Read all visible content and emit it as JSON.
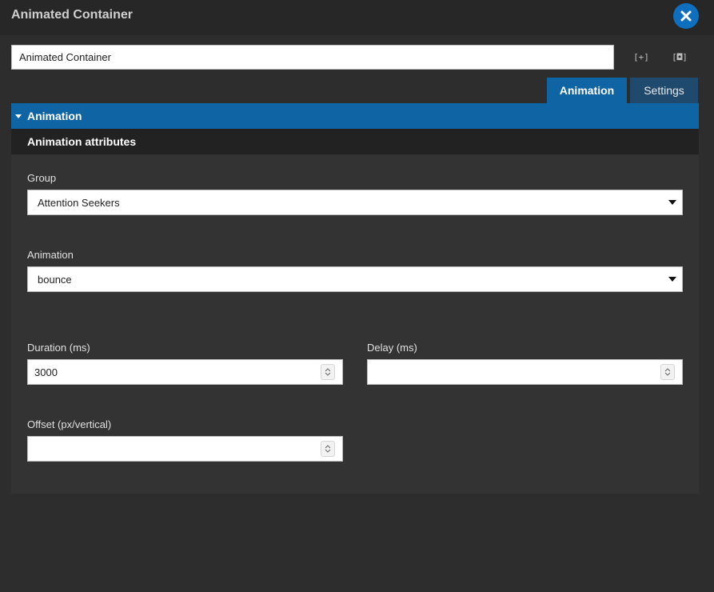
{
  "header": {
    "title": "Animated Container"
  },
  "toolbar": {
    "name_value": "Animated Container",
    "expand_icon_text": "[+]",
    "inspect_icon_text": "[◘]"
  },
  "tabs": [
    {
      "label": "Animation",
      "active": true
    },
    {
      "label": "Settings",
      "active": false
    }
  ],
  "section": {
    "title": "Animation",
    "subtitle": "Animation attributes"
  },
  "fields": {
    "group": {
      "label": "Group",
      "value": "Attention Seekers"
    },
    "animation": {
      "label": "Animation",
      "value": "bounce"
    },
    "duration": {
      "label": "Duration (ms)",
      "value": "3000"
    },
    "delay": {
      "label": "Delay (ms)",
      "value": ""
    },
    "offset": {
      "label": "Offset (px/vertical)",
      "value": ""
    }
  },
  "colors": {
    "accent": "#0f64a3",
    "background": "#2d2d2d",
    "panel": "#333333",
    "subheader": "#222222"
  },
  "icons": {
    "close": "close-icon",
    "expand": "expand-icon",
    "inspect": "inspect-icon",
    "caret": "caret-down-icon",
    "dropdown": "chevron-down-icon",
    "spinner": "spinner-icon"
  }
}
